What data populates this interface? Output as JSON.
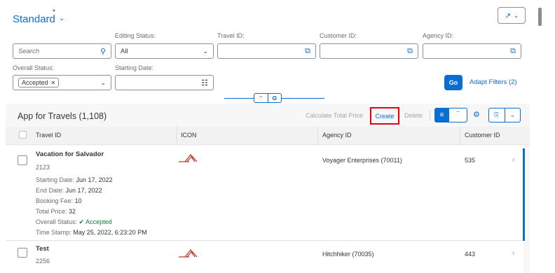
{
  "header": {
    "variant_title": "Standard",
    "variant_modified": "*",
    "share_icon": "share-icon"
  },
  "filters": {
    "search_placeholder": "Search",
    "editing_status": {
      "label": "Editing Status:",
      "value": "All"
    },
    "travel_id": {
      "label": "Travel ID:",
      "value": ""
    },
    "customer_id": {
      "label": "Customer ID:",
      "value": ""
    },
    "agency_id": {
      "label": "Agency ID:",
      "value": ""
    },
    "overall_status": {
      "label": "Overall Status:",
      "token": "Accepted"
    },
    "starting_date": {
      "label": "Starting Date:",
      "value": ""
    },
    "go_label": "Go",
    "adapt_label": "Adapt Filters (2)"
  },
  "table": {
    "title": "App for Travels (1,108)",
    "toolbar": {
      "calc_label": "Calculate Total Price",
      "create_label": "Create",
      "delete_label": "Delete"
    },
    "columns": [
      "Travel ID",
      "ICON",
      "Agency ID",
      "Customer ID"
    ],
    "rows": [
      {
        "title": "Vacation for Salvador",
        "id": "2123",
        "details": [
          {
            "label": "Starting Date:",
            "value": "Jun 17, 2022"
          },
          {
            "label": "End Date:",
            "value": "Jun 17, 2022"
          },
          {
            "label": "Booking Fee:",
            "value": "10"
          },
          {
            "label": "Total Price:",
            "value": "32"
          },
          {
            "label": "Overall Status:",
            "value": "Accepted"
          },
          {
            "label": "Time Stamp:",
            "value": "May 25, 2022, 6:23:20 PM"
          }
        ],
        "agency": "Voyager Enterprises (70011)",
        "customer": "535"
      },
      {
        "title": "Test",
        "id": "2256",
        "agency": "Hitchhiker (70035)",
        "customer": "443"
      }
    ]
  },
  "colors": {
    "accent": "#0a6ed1",
    "highlight": "#e2000f",
    "positive": "#107e3e",
    "icon": "#c0392b"
  }
}
